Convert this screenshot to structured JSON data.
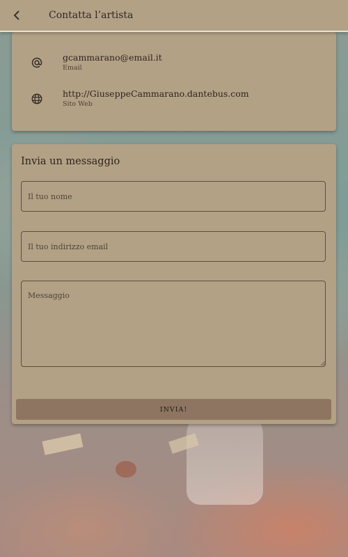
{
  "appbar": {
    "title": "Contatta l’artista",
    "back_icon": "chevron-left-icon"
  },
  "contacts": [
    {
      "icon": "at-sign-icon",
      "value": "gcammarano@email.it",
      "label": "Email"
    },
    {
      "icon": "globe-icon",
      "value": "http://GiuseppeCammarano.dantebus.com",
      "label": "Sito Web"
    }
  ],
  "form": {
    "title": "Invia un messaggio",
    "name_placeholder": "Il tuo nome",
    "email_placeholder": "Il tuo indirizzo email",
    "message_placeholder": "Messaggio",
    "submit_label": "INVIA!"
  },
  "colors": {
    "surface": "#b3a186",
    "button": "#8e7561",
    "text": "#2b251d"
  }
}
